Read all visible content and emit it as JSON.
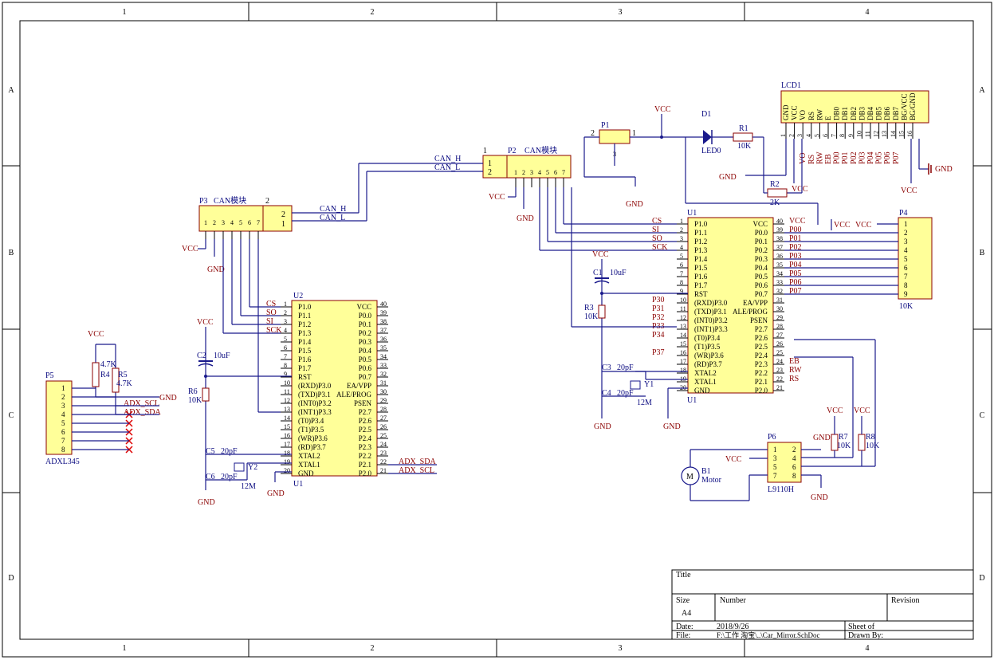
{
  "border": {
    "cols": [
      "1",
      "2",
      "3",
      "4"
    ],
    "rows": [
      "A",
      "B",
      "C",
      "D"
    ]
  },
  "title_block": {
    "title_label": "Title",
    "size_label": "Size",
    "size_value": "A4",
    "number_label": "Number",
    "revision_label": "Revision",
    "date_label": "Date:",
    "date_value": "2018/9/26",
    "file_label": "File:",
    "file_value": "F:\\工作 淘宝\\..\\Car_Mirror.SchDoc",
    "sheet_label": "Sheet   of",
    "drawn_label": "Drawn By:"
  },
  "mcu": {
    "left_pins": [
      "P1.0",
      "P1.1",
      "P1.2",
      "P1.3",
      "P1.4",
      "P1.5",
      "P1.6",
      "P1.7",
      "RST",
      "(RXD)P3.0",
      "(TXD)P3.1",
      "(INT0)P3.2",
      "(INT1)P3.3",
      "(T0)P3.4",
      "(T1)P3.5",
      "(WR)P3.6",
      "(RD)P3.7",
      "XTAL2",
      "XTAL1",
      "GND"
    ],
    "right_pins": [
      "VCC",
      "P0.0",
      "P0.1",
      "P0.2",
      "P0.3",
      "P0.4",
      "P0.5",
      "P0.6",
      "P0.7",
      "EA/VPP",
      "ALE/PROG",
      "PSEN",
      "P2.7",
      "P2.6",
      "P2.5",
      "P2.4",
      "P2.3",
      "P2.2",
      "P2.1",
      "P2.0"
    ],
    "left_nums": [
      "1",
      "2",
      "3",
      "4",
      "5",
      "6",
      "7",
      "8",
      "9",
      "10",
      "11",
      "12",
      "13",
      "14",
      "15",
      "16",
      "17",
      "18",
      "19",
      "20"
    ],
    "right_nums": [
      "40",
      "39",
      "38",
      "37",
      "36",
      "35",
      "34",
      "33",
      "32",
      "31",
      "30",
      "29",
      "28",
      "27",
      "26",
      "25",
      "24",
      "23",
      "22",
      "21"
    ]
  },
  "u1_main": {
    "top_label": "U1",
    "bottom_label": "U1",
    "left_nets": [
      "CS",
      "SI",
      "SO",
      "SCK",
      "",
      "",
      "",
      "",
      "",
      "P30",
      "P31",
      "P32",
      "P33",
      "P34",
      "",
      "P37",
      "",
      "",
      "",
      ""
    ],
    "right_nets": [
      "VCC",
      "P00",
      "P01",
      "P02",
      "P03",
      "P04",
      "P05",
      "P06",
      "P07",
      "",
      "",
      "",
      "",
      "",
      "",
      "",
      "EB",
      "RW",
      "RS",
      ""
    ]
  },
  "u2": {
    "top_label": "U2",
    "bottom_label": "U1",
    "left_nets": [
      "CS",
      "SO",
      "SI",
      "SCK"
    ],
    "right_nets": [
      "ADX_SDA",
      "ADX_SCL"
    ]
  },
  "lcd": {
    "ref": "LCD1",
    "pins": [
      "GND",
      "VCC",
      "VO",
      "RS",
      "RW",
      "E",
      "DB0",
      "DB1",
      "DB2",
      "DB3",
      "DB4",
      "DB5",
      "DB6",
      "DB7",
      "BG/VCC",
      "BG/GND"
    ],
    "nums": [
      "1",
      "2",
      "3",
      "4",
      "5",
      "6",
      "7",
      "8",
      "9",
      "10",
      "11",
      "12",
      "13",
      "14",
      "15",
      "16"
    ],
    "nets": [
      "",
      "",
      "VO",
      "RS",
      "RW",
      "EB",
      "P00",
      "P01",
      "P02",
      "P03",
      "P04",
      "P05",
      "P06",
      "P07",
      "",
      ""
    ]
  },
  "p4": {
    "ref": "P4",
    "nums": [
      "1",
      "2",
      "3",
      "4",
      "5",
      "6",
      "7",
      "8",
      "9"
    ],
    "value": "10K"
  },
  "p1": {
    "ref": "P1",
    "pin1": "1",
    "pin2": "2",
    "pin3": "3"
  },
  "p2": {
    "ref": "P2",
    "name": "CAN模块",
    "nums": [
      "1",
      "2",
      "3",
      "4",
      "5",
      "6",
      "7"
    ],
    "pin_a": "1",
    "pin_b": "2",
    "net_h": "CAN_H",
    "net_l": "CAN_L"
  },
  "p3": {
    "ref": "P3",
    "name": "CAN模块",
    "nums": [
      "1",
      "2",
      "3",
      "4",
      "5",
      "6",
      "7"
    ],
    "pin_a": "2",
    "pin_b": "1",
    "net_h": "CAN_H",
    "net_l": "CAN_L"
  },
  "p5": {
    "ref": "P5",
    "name": "ADXL345",
    "nums": [
      "1",
      "2",
      "3",
      "4",
      "5",
      "6",
      "7",
      "8"
    ],
    "net_scl": "ADX_SCL",
    "net_sda": "ADX_SDA"
  },
  "p6": {
    "ref": "P6",
    "name": "L9110H",
    "nums_left": [
      "1",
      "3",
      "5",
      "7"
    ],
    "nums_right": [
      "2",
      "4",
      "6",
      "8"
    ]
  },
  "parts": {
    "d1": "D1",
    "led0": "LED0",
    "r1": "R1",
    "r1v": "10K",
    "r2": "R2",
    "r2v": "2K",
    "r3": "R3",
    "r3v": "10K",
    "c1": "C1",
    "c1v": "10uF",
    "c3": "C3",
    "c3v": "20pF",
    "c4": "C4",
    "c4v": "20pF",
    "y1": "Y1",
    "y1v": "12M",
    "r4": "R4",
    "r4v": "4.7K",
    "r5": "R5",
    "r5v": "4.7K",
    "r6": "R6",
    "r6v": "10K",
    "c2": "C2",
    "c2v": "10uF",
    "c5": "C5",
    "c5v": "20pF",
    "c6": "C6",
    "c6v": "20pF",
    "y2": "Y2",
    "y2v": "12M",
    "r7": "R7",
    "r7v": "10K",
    "r8": "R8",
    "r8v": "10K",
    "b1": "B1",
    "b1v": "Motor",
    "motor_symbol": "M"
  },
  "power": {
    "vcc": "VCC",
    "gnd": "GND"
  }
}
